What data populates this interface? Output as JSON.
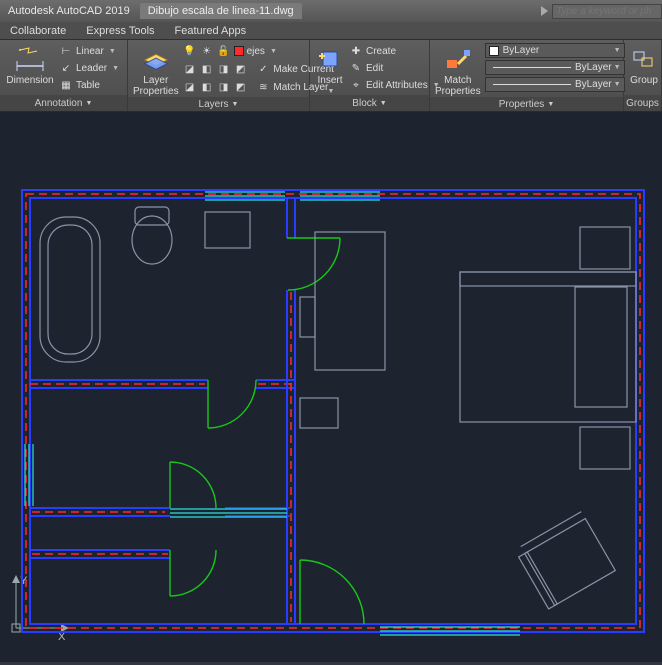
{
  "title": {
    "app": "Autodesk AutoCAD 2019",
    "file": "Dibujo escala de linea-11.dwg"
  },
  "search": {
    "placeholder": "Type a keyword or ph"
  },
  "menutabs": {
    "collaborate": "Collaborate",
    "express": "Express Tools",
    "featured": "Featured Apps"
  },
  "ribbon": {
    "annotation": {
      "label": "Annotation",
      "dimension": "Dimension",
      "linear": "Linear",
      "leader": "Leader",
      "table": "Table"
    },
    "layers": {
      "label": "Layers",
      "layerprops": "Layer\nProperties",
      "current": "ejes",
      "makecurrent": "Make Current",
      "matchlayer": "Match Layer"
    },
    "block": {
      "label": "Block",
      "insert": "Insert",
      "create": "Create",
      "edit": "Edit",
      "editattrs": "Edit Attributes"
    },
    "properties": {
      "label": "Properties",
      "matchprops": "Match\nProperties",
      "color": "ByLayer",
      "line1": "ByLayer",
      "line2": "ByLayer"
    },
    "groups": {
      "label": "Groups",
      "group": "Group"
    }
  },
  "ucs": {
    "x": "X",
    "y": "Y"
  },
  "colors": {
    "blue": "#2a3cff",
    "red": "#ff2a2a",
    "cyan": "#26e0e0",
    "green": "#18c818",
    "fixture": "#8a94a8",
    "bg": "#1d2430"
  }
}
